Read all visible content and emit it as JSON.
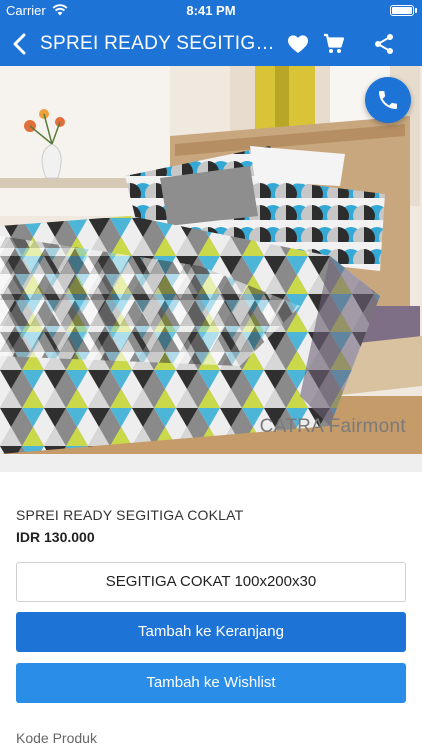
{
  "status_bar": {
    "carrier": "Carrier",
    "time": "8:41 PM"
  },
  "nav": {
    "title": "SPREI READY SEGITIGA COKLAT"
  },
  "product": {
    "brand_watermark": "CATRA Fairmont",
    "name": "SPREI READY SEGITIGA COKLAT",
    "price": "IDR 130.000",
    "variant": "SEGITIGA COKAT 100x200x30",
    "add_to_cart_label": "Tambah ke Keranjang",
    "add_to_wishlist_label": "Tambah ke Wishlist",
    "code_label": "Kode Produk"
  },
  "colors": {
    "primary": "#1e73d6",
    "secondary": "#2a8de8"
  },
  "icons": [
    "wifi-icon",
    "battery-icon",
    "back-icon",
    "heart-icon",
    "cart-icon",
    "share-icon",
    "phone-icon"
  ]
}
